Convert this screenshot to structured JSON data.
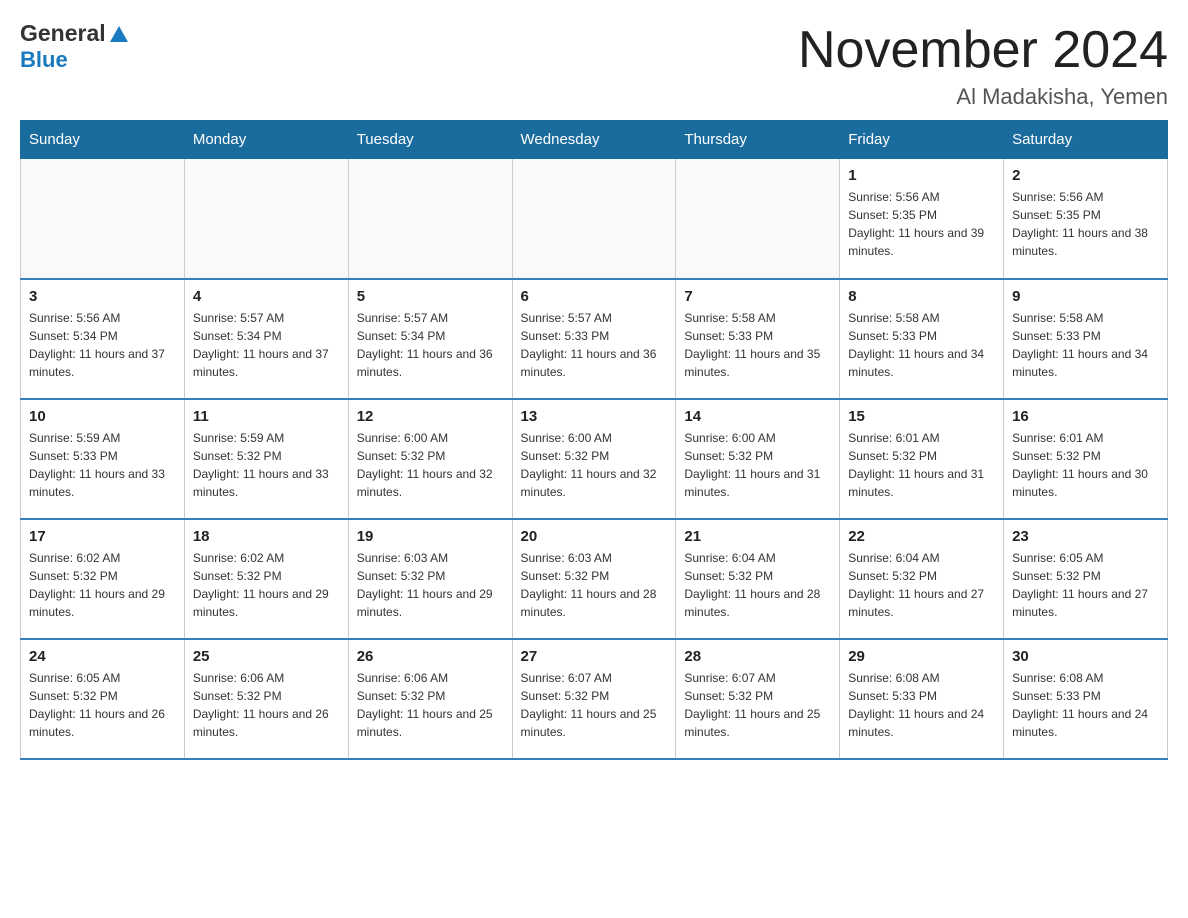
{
  "header": {
    "title": "November 2024",
    "subtitle": "Al Madakisha, Yemen",
    "logo_general": "General",
    "logo_blue": "Blue"
  },
  "days_of_week": [
    "Sunday",
    "Monday",
    "Tuesday",
    "Wednesday",
    "Thursday",
    "Friday",
    "Saturday"
  ],
  "weeks": [
    [
      {
        "day": "",
        "info": ""
      },
      {
        "day": "",
        "info": ""
      },
      {
        "day": "",
        "info": ""
      },
      {
        "day": "",
        "info": ""
      },
      {
        "day": "",
        "info": ""
      },
      {
        "day": "1",
        "info": "Sunrise: 5:56 AM\nSunset: 5:35 PM\nDaylight: 11 hours and 39 minutes."
      },
      {
        "day": "2",
        "info": "Sunrise: 5:56 AM\nSunset: 5:35 PM\nDaylight: 11 hours and 38 minutes."
      }
    ],
    [
      {
        "day": "3",
        "info": "Sunrise: 5:56 AM\nSunset: 5:34 PM\nDaylight: 11 hours and 37 minutes."
      },
      {
        "day": "4",
        "info": "Sunrise: 5:57 AM\nSunset: 5:34 PM\nDaylight: 11 hours and 37 minutes."
      },
      {
        "day": "5",
        "info": "Sunrise: 5:57 AM\nSunset: 5:34 PM\nDaylight: 11 hours and 36 minutes."
      },
      {
        "day": "6",
        "info": "Sunrise: 5:57 AM\nSunset: 5:33 PM\nDaylight: 11 hours and 36 minutes."
      },
      {
        "day": "7",
        "info": "Sunrise: 5:58 AM\nSunset: 5:33 PM\nDaylight: 11 hours and 35 minutes."
      },
      {
        "day": "8",
        "info": "Sunrise: 5:58 AM\nSunset: 5:33 PM\nDaylight: 11 hours and 34 minutes."
      },
      {
        "day": "9",
        "info": "Sunrise: 5:58 AM\nSunset: 5:33 PM\nDaylight: 11 hours and 34 minutes."
      }
    ],
    [
      {
        "day": "10",
        "info": "Sunrise: 5:59 AM\nSunset: 5:33 PM\nDaylight: 11 hours and 33 minutes."
      },
      {
        "day": "11",
        "info": "Sunrise: 5:59 AM\nSunset: 5:32 PM\nDaylight: 11 hours and 33 minutes."
      },
      {
        "day": "12",
        "info": "Sunrise: 6:00 AM\nSunset: 5:32 PM\nDaylight: 11 hours and 32 minutes."
      },
      {
        "day": "13",
        "info": "Sunrise: 6:00 AM\nSunset: 5:32 PM\nDaylight: 11 hours and 32 minutes."
      },
      {
        "day": "14",
        "info": "Sunrise: 6:00 AM\nSunset: 5:32 PM\nDaylight: 11 hours and 31 minutes."
      },
      {
        "day": "15",
        "info": "Sunrise: 6:01 AM\nSunset: 5:32 PM\nDaylight: 11 hours and 31 minutes."
      },
      {
        "day": "16",
        "info": "Sunrise: 6:01 AM\nSunset: 5:32 PM\nDaylight: 11 hours and 30 minutes."
      }
    ],
    [
      {
        "day": "17",
        "info": "Sunrise: 6:02 AM\nSunset: 5:32 PM\nDaylight: 11 hours and 29 minutes."
      },
      {
        "day": "18",
        "info": "Sunrise: 6:02 AM\nSunset: 5:32 PM\nDaylight: 11 hours and 29 minutes."
      },
      {
        "day": "19",
        "info": "Sunrise: 6:03 AM\nSunset: 5:32 PM\nDaylight: 11 hours and 29 minutes."
      },
      {
        "day": "20",
        "info": "Sunrise: 6:03 AM\nSunset: 5:32 PM\nDaylight: 11 hours and 28 minutes."
      },
      {
        "day": "21",
        "info": "Sunrise: 6:04 AM\nSunset: 5:32 PM\nDaylight: 11 hours and 28 minutes."
      },
      {
        "day": "22",
        "info": "Sunrise: 6:04 AM\nSunset: 5:32 PM\nDaylight: 11 hours and 27 minutes."
      },
      {
        "day": "23",
        "info": "Sunrise: 6:05 AM\nSunset: 5:32 PM\nDaylight: 11 hours and 27 minutes."
      }
    ],
    [
      {
        "day": "24",
        "info": "Sunrise: 6:05 AM\nSunset: 5:32 PM\nDaylight: 11 hours and 26 minutes."
      },
      {
        "day": "25",
        "info": "Sunrise: 6:06 AM\nSunset: 5:32 PM\nDaylight: 11 hours and 26 minutes."
      },
      {
        "day": "26",
        "info": "Sunrise: 6:06 AM\nSunset: 5:32 PM\nDaylight: 11 hours and 25 minutes."
      },
      {
        "day": "27",
        "info": "Sunrise: 6:07 AM\nSunset: 5:32 PM\nDaylight: 11 hours and 25 minutes."
      },
      {
        "day": "28",
        "info": "Sunrise: 6:07 AM\nSunset: 5:32 PM\nDaylight: 11 hours and 25 minutes."
      },
      {
        "day": "29",
        "info": "Sunrise: 6:08 AM\nSunset: 5:33 PM\nDaylight: 11 hours and 24 minutes."
      },
      {
        "day": "30",
        "info": "Sunrise: 6:08 AM\nSunset: 5:33 PM\nDaylight: 11 hours and 24 minutes."
      }
    ]
  ]
}
